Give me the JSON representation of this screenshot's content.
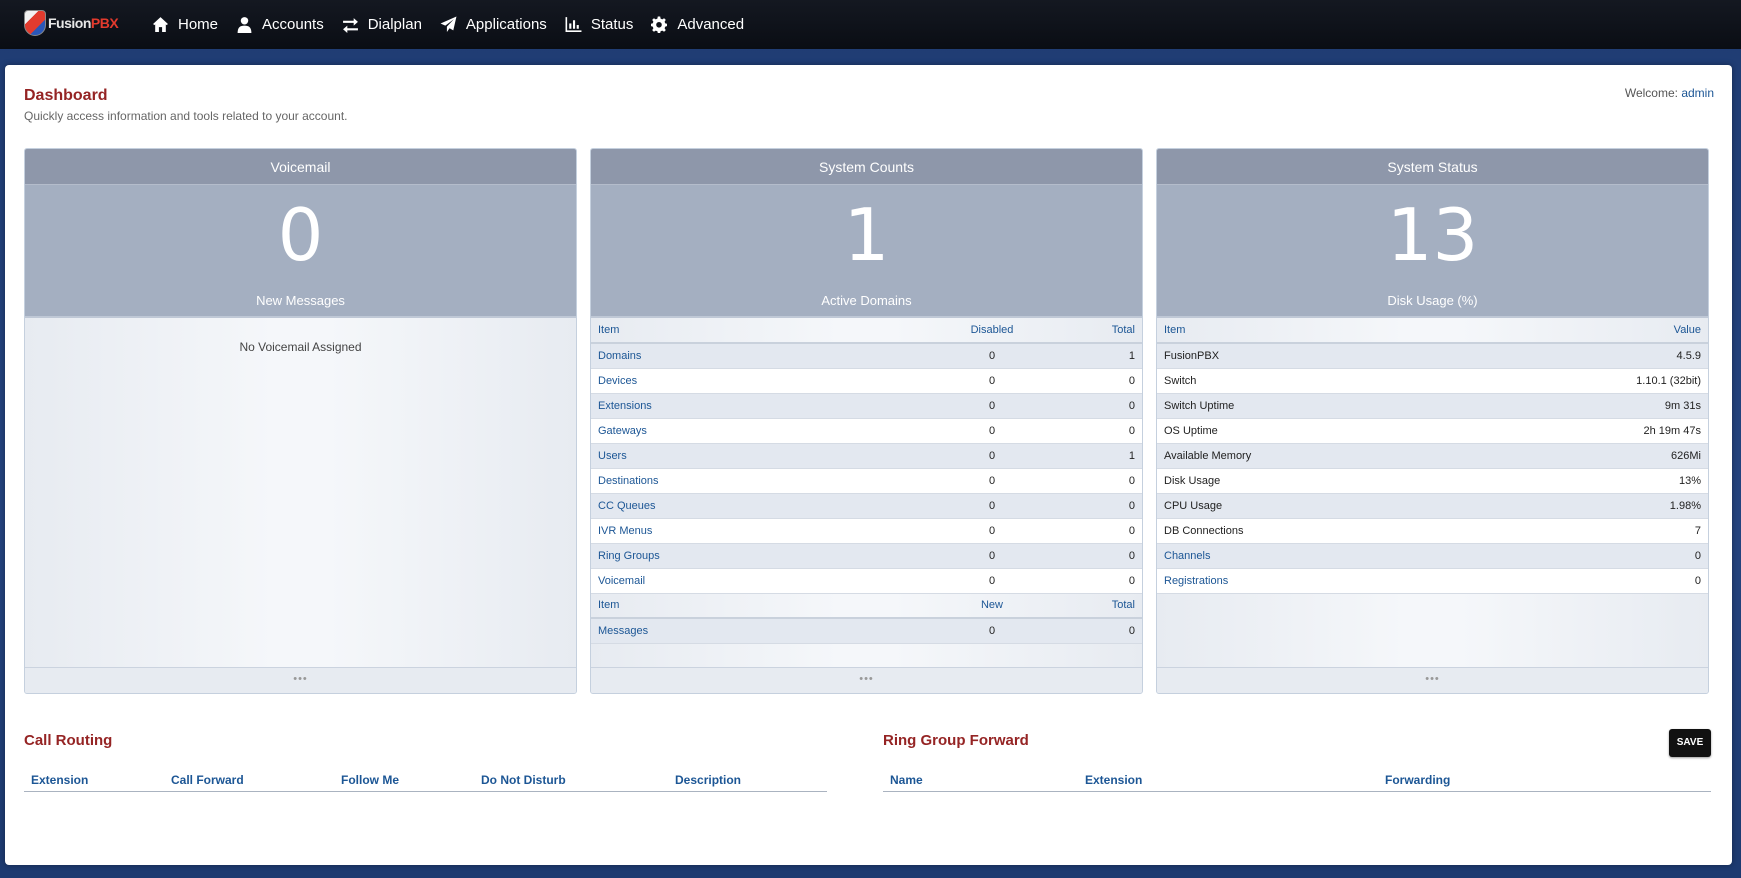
{
  "brand": {
    "prefix": "Fusion",
    "suffix": "PBX"
  },
  "nav": [
    {
      "label": "Home",
      "icon": "home-icon"
    },
    {
      "label": "Accounts",
      "icon": "user-icon"
    },
    {
      "label": "Dialplan",
      "icon": "exchange-icon"
    },
    {
      "label": "Applications",
      "icon": "paper-plane-icon"
    },
    {
      "label": "Status",
      "icon": "bar-chart-icon"
    },
    {
      "label": "Advanced",
      "icon": "gear-icon"
    }
  ],
  "page": {
    "title": "Dashboard",
    "description": "Quickly access information and tools related to your account.",
    "welcome_label": "Welcome:",
    "welcome_user": "admin"
  },
  "voicemail": {
    "title": "Voicemail",
    "count": "0",
    "count_label": "New Messages",
    "empty_note": "No Voicemail Assigned",
    "footer": "•••"
  },
  "system_counts": {
    "title": "System Counts",
    "count": "1",
    "count_label": "Active Domains",
    "headers": [
      "Item",
      "Disabled",
      "Total"
    ],
    "rows": [
      {
        "item": "Domains",
        "disabled": "0",
        "total": "1"
      },
      {
        "item": "Devices",
        "disabled": "0",
        "total": "0"
      },
      {
        "item": "Extensions",
        "disabled": "0",
        "total": "0"
      },
      {
        "item": "Gateways",
        "disabled": "0",
        "total": "0"
      },
      {
        "item": "Users",
        "disabled": "0",
        "total": "1"
      },
      {
        "item": "Destinations",
        "disabled": "0",
        "total": "0"
      },
      {
        "item": "CC Queues",
        "disabled": "0",
        "total": "0"
      },
      {
        "item": "IVR Menus",
        "disabled": "0",
        "total": "0"
      },
      {
        "item": "Ring Groups",
        "disabled": "0",
        "total": "0"
      },
      {
        "item": "Voicemail",
        "disabled": "0",
        "total": "0"
      }
    ],
    "headers2": [
      "Item",
      "New",
      "Total"
    ],
    "rows2": [
      {
        "item": "Messages",
        "new": "0",
        "total": "0"
      }
    ],
    "footer": "•••"
  },
  "system_status": {
    "title": "System Status",
    "count": "13",
    "count_label": "Disk Usage (%)",
    "headers": [
      "Item",
      "Value"
    ],
    "rows": [
      {
        "item": "FusionPBX",
        "value": "4.5.9",
        "link": false
      },
      {
        "item": "Switch",
        "value": "1.10.1 (32bit)",
        "link": false
      },
      {
        "item": "Switch Uptime",
        "value": "9m 31s",
        "link": false
      },
      {
        "item": "OS Uptime",
        "value": "2h 19m 47s",
        "link": false
      },
      {
        "item": "Available Memory",
        "value": "626Mi",
        "link": false
      },
      {
        "item": "Disk Usage",
        "value": "13%",
        "link": false
      },
      {
        "item": "CPU Usage",
        "value": "1.98%",
        "link": false
      },
      {
        "item": "DB Connections",
        "value": "7",
        "link": false
      },
      {
        "item": "Channels",
        "value": "0",
        "link": true
      },
      {
        "item": "Registrations",
        "value": "0",
        "link": true
      }
    ],
    "footer": "•••"
  },
  "call_routing": {
    "title": "Call Routing",
    "columns": [
      "Extension",
      "Call Forward",
      "Follow Me",
      "Do Not Disturb",
      "Description"
    ]
  },
  "ring_group_forward": {
    "title": "Ring Group Forward",
    "save_label": "SAVE",
    "columns": [
      "Name",
      "Extension",
      "Forwarding"
    ]
  }
}
